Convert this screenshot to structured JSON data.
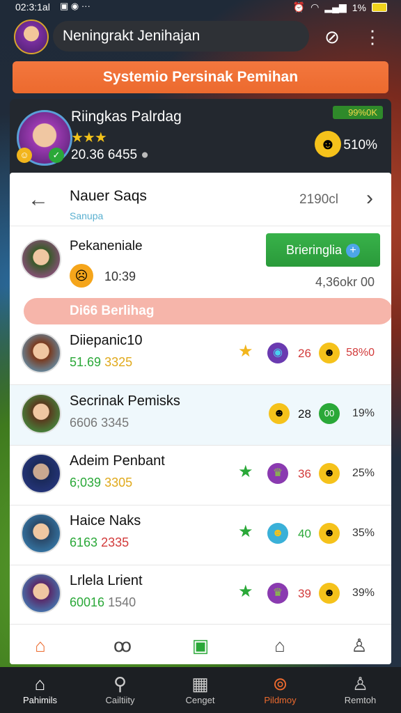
{
  "status": {
    "time": "02:3:1al",
    "battery": "1%"
  },
  "header": {
    "search_text": "Neningrakt Jenihajan"
  },
  "banner": {
    "text": "Systemio Persinak Pemihan"
  },
  "profile": {
    "name": "Riingkas Palrdag",
    "stars": "★★★",
    "score": "20.36 6455",
    "chip": "99%0K",
    "percent": "510%"
  },
  "panel": {
    "title": "Nauer Saqs",
    "subtitle": "Sanupa",
    "right_value": "2190cl",
    "featured": {
      "name": "Pekaneniale",
      "value": "10:39",
      "button": "Brieringlia",
      "right": "4,36okr  00"
    },
    "pink_bar": "Di66 Berlihag",
    "rows": [
      {
        "name": "Diiepanic10",
        "a": "51.69",
        "b": "3325",
        "num": "26",
        "pct": "58%0"
      },
      {
        "name": "Secrinak Pemisks",
        "a": "6606",
        "b": "3345",
        "num": "28",
        "pct": "19%"
      },
      {
        "name": "Adeim Penbant",
        "a": "6;039",
        "b": "3305",
        "num": "36",
        "pct": "25%"
      },
      {
        "name": "Haice Naks",
        "a": "6163",
        "b": "2335",
        "num": "40",
        "pct": "35%"
      },
      {
        "name": "Lrlela Lrient",
        "a": "60016",
        "b": "1540",
        "num": "39",
        "pct": "39%"
      }
    ]
  },
  "bottom_nav": [
    {
      "label": "Pahimils",
      "icon": "home-icon"
    },
    {
      "label": "Cailtiity",
      "icon": "search-icon"
    },
    {
      "label": "Cenget",
      "icon": "grid-icon"
    },
    {
      "label": "Pildmoy",
      "icon": "map-pin-icon"
    },
    {
      "label": "Remtoh",
      "icon": "user-icon"
    }
  ]
}
